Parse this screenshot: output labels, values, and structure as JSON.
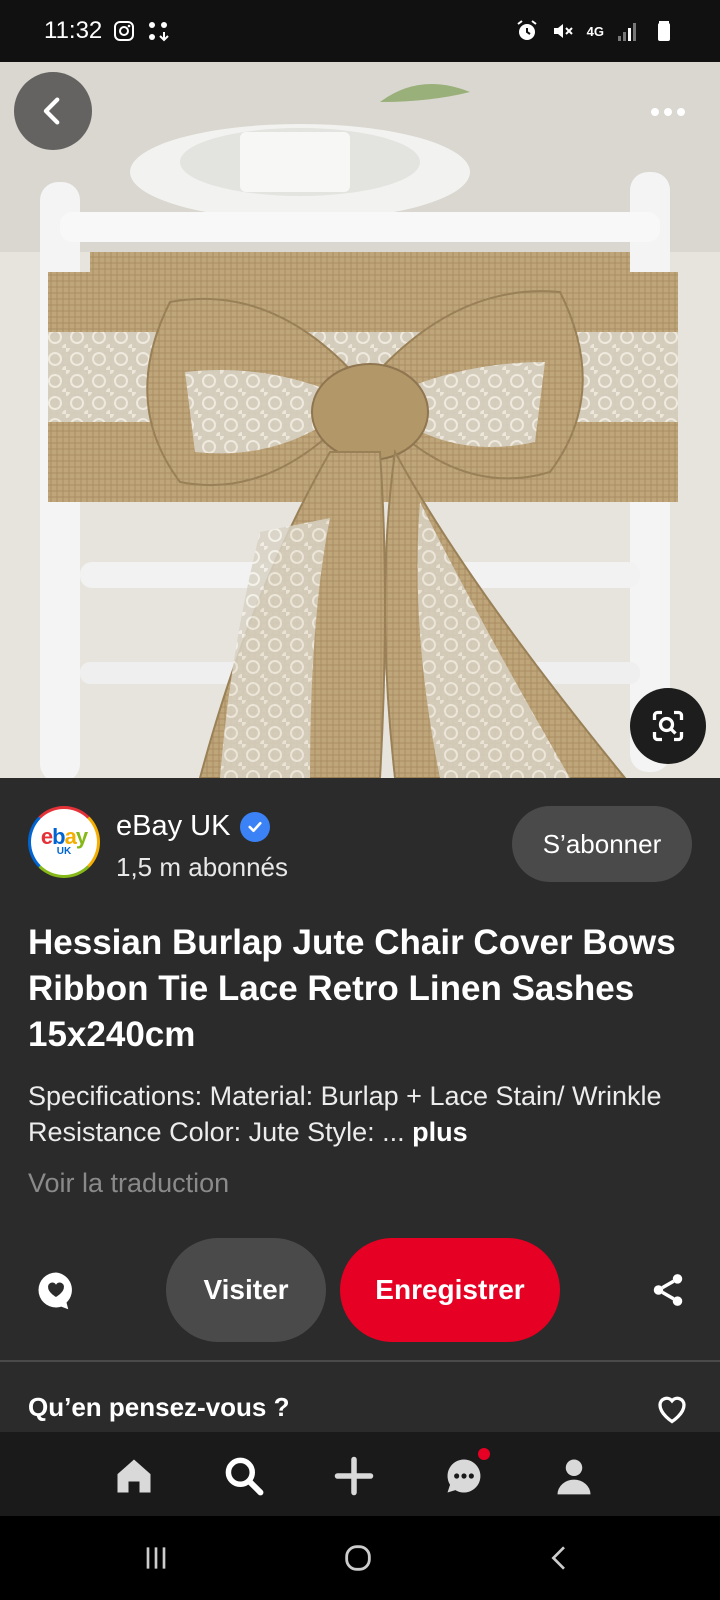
{
  "status_bar": {
    "time": "11:32",
    "network": "4G"
  },
  "hero": {
    "image_alt": "Hessian burlap and lace bow tied on a white chair"
  },
  "author": {
    "avatar_logo": "ebay",
    "avatar_sub": "UK",
    "name": "eBay UK",
    "verified": true,
    "followers": "1,5 m abonnés",
    "subscribe_label": "S’abonner"
  },
  "pin": {
    "title": "Hessian Burlap Jute Chair Cover Bows Ribbon Tie Lace Retro Linen Sashes 15x240cm",
    "description": "Specifications: Material: Burlap + Lace Stain/ Wrinkle Resistance Color: Jute Style: ...",
    "more_label": "plus",
    "translate_label": "Voir la traduction"
  },
  "actions": {
    "visit_label": "Visiter",
    "save_label": "Enregistrer"
  },
  "feedback": {
    "label": "Qu’en pensez-vous ?"
  },
  "bottom_nav": {
    "items": [
      "home-icon",
      "search-icon",
      "add-icon",
      "messages-icon",
      "profile-icon"
    ],
    "messages_has_notification": true
  },
  "colors": {
    "background": "#2b2b2b",
    "save_button": "#e60023",
    "secondary_button": "#4a4a4a",
    "verified": "#3b82f6"
  }
}
